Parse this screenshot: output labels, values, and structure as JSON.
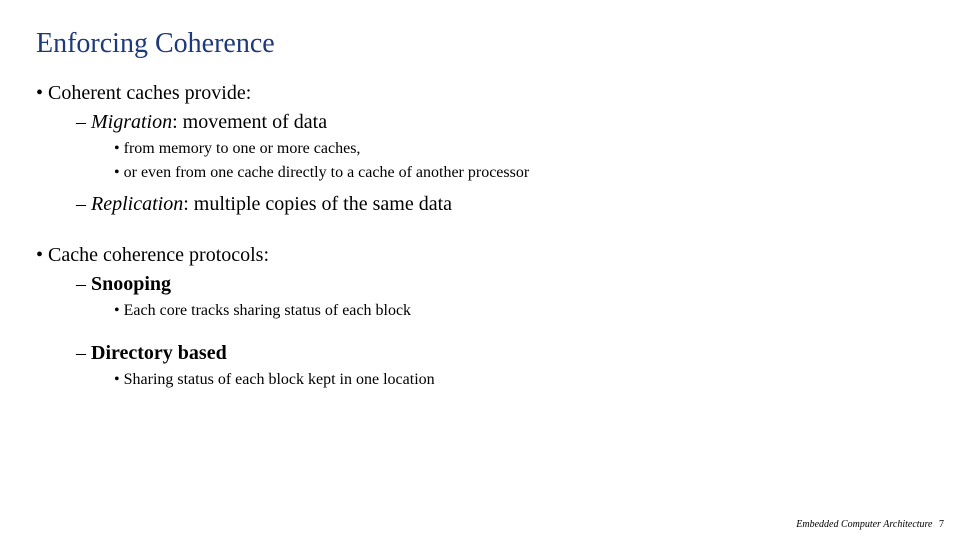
{
  "title": "Enforcing Coherence",
  "b1": {
    "text": "Coherent caches provide:"
  },
  "b1a": {
    "term": "Migration",
    "rest": ":   movement of data"
  },
  "b1a_i": "from memory to one or more caches,",
  "b1a_ii": "or even from one cache directly to a cache of another processor",
  "b1b": {
    "term": "Replication",
    "rest": ":  multiple copies of the same data"
  },
  "b2": {
    "text": "Cache coherence protocols:"
  },
  "b2a": {
    "term": "Snooping"
  },
  "b2a_i": "Each core tracks sharing status of each block",
  "b2b": {
    "term": "Directory based"
  },
  "b2b_i": "Sharing status of each block kept in one location",
  "footer": {
    "course": "Embedded Computer Architecture",
    "page": "7"
  }
}
